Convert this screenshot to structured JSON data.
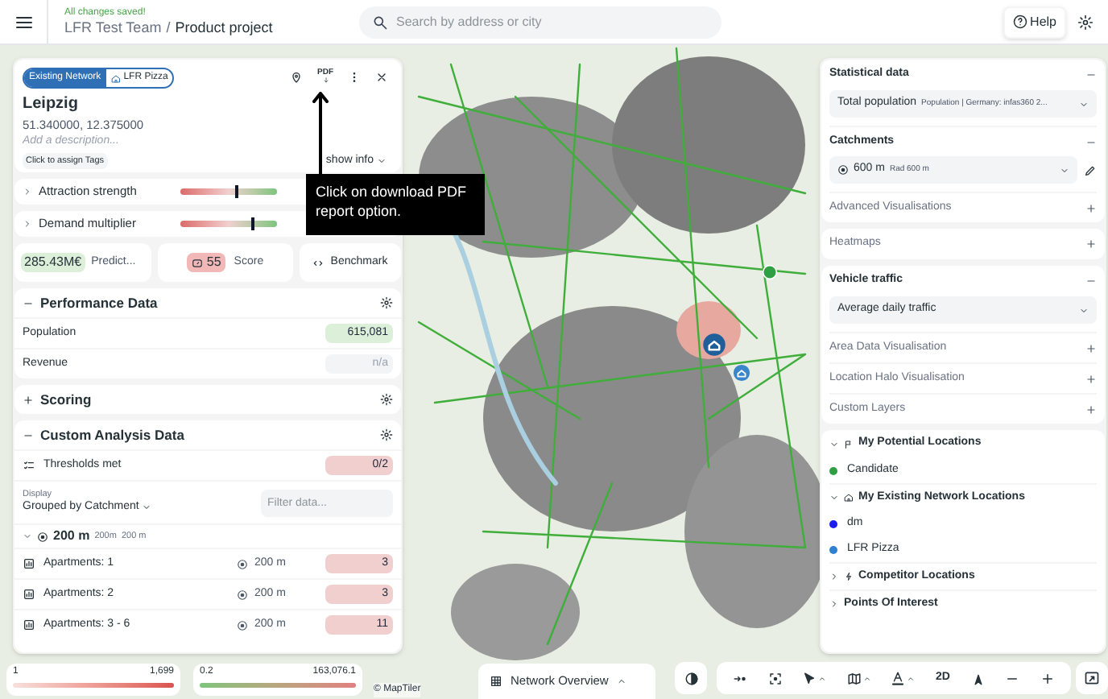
{
  "header": {
    "status": "All changes saved!",
    "team": "LFR Test Team",
    "separator": "/",
    "project": "Product project",
    "search_placeholder": "Search by address or city",
    "help": "Help"
  },
  "location": {
    "tags": [
      "Existing Network",
      "LFR Pizza"
    ],
    "pdf": "PDF",
    "title": "Leipzig",
    "coords": "51.340000, 12.375000",
    "description_placeholder": "Add a description...",
    "tags_button": "Click to assign Tags",
    "show_info": "show info"
  },
  "tooltip": "Click on download PDF report option.",
  "sliders": [
    {
      "label": "Attraction strength",
      "level": 0.56
    },
    {
      "label": "Demand multiplier",
      "level": 0.73
    }
  ],
  "metrics": {
    "value": "285.43M€",
    "value_label": "Predict...",
    "score": "55",
    "score_label": "Score",
    "benchmark": "Benchmark"
  },
  "performance": {
    "title": "Performance Data",
    "expanded": true,
    "rows": [
      {
        "label": "Population",
        "value": "615,081",
        "kind": "good"
      },
      {
        "label": "Revenue",
        "value": "n/a",
        "kind": "na"
      }
    ]
  },
  "scoring": {
    "title": "Scoring",
    "expanded": false
  },
  "custom_analysis": {
    "title": "Custom Analysis Data",
    "expanded": true,
    "thresholds": {
      "label": "Thresholds met",
      "value": "0/2",
      "kind": "bad"
    },
    "display_label": "Display",
    "grouping": "Grouped by Catchment",
    "filter_placeholder": "Filter data...",
    "group": {
      "label": "200 m",
      "sub": [
        "200m",
        "200 m"
      ],
      "expanded": true,
      "rows": [
        {
          "label": "Apartments: 1",
          "radius": "200 m",
          "value": "3",
          "kind": "bad"
        },
        {
          "label": "Apartments: 2",
          "radius": "200 m",
          "value": "3",
          "kind": "bad"
        },
        {
          "label": "Apartments: 3 - 6",
          "radius": "200 m",
          "value": "11",
          "kind": "bad"
        }
      ]
    }
  },
  "legends": [
    {
      "min": "1",
      "max": "1,699",
      "kind": "red"
    },
    {
      "min": "0.2",
      "max": "163,076.1",
      "kind": "green"
    }
  ],
  "attribution": "© MapTiler",
  "network_overview": "Network Overview",
  "map_toolbar": {
    "view_mode": "2D"
  },
  "right_cards": [
    {
      "sections": [
        {
          "title": "Statistical data",
          "expanded": true,
          "select": {
            "label": "Total population",
            "detail": "Population | Germany: infas360 2..."
          }
        },
        {
          "title": "Catchments",
          "expanded": true,
          "select": {
            "label": "600 m",
            "detail": "Rad 600 m",
            "kind": "radius"
          }
        },
        {
          "title": "Advanced Visualisations",
          "expanded": false
        }
      ]
    },
    {
      "sections": [
        {
          "title": "Heatmaps",
          "expanded": false
        }
      ]
    },
    {
      "sections": [
        {
          "title": "Vehicle traffic",
          "expanded": true,
          "select": {
            "label": "Average daily traffic"
          }
        },
        {
          "title": "Area Data Visualisation",
          "expanded": false
        },
        {
          "title": "Location Halo Visualisation",
          "expanded": false
        },
        {
          "title": "Custom Layers",
          "expanded": false
        }
      ]
    }
  ],
  "layers": [
    {
      "title": "My Potential Locations",
      "kind": "potential",
      "expanded": true,
      "items": [
        {
          "label": "Candidate",
          "color": "#2ea043"
        }
      ]
    },
    {
      "title": "My Existing Network Locations",
      "kind": "network",
      "expanded": true,
      "items": [
        {
          "label": "dm",
          "color": "#1d1df0"
        },
        {
          "label": "LFR Pizza",
          "color": "#2f80d0"
        }
      ]
    },
    {
      "title": "Competitor Locations",
      "kind": "competitor",
      "expanded": false
    },
    {
      "title": "Points Of Interest",
      "kind": "poi",
      "expanded": false
    }
  ]
}
